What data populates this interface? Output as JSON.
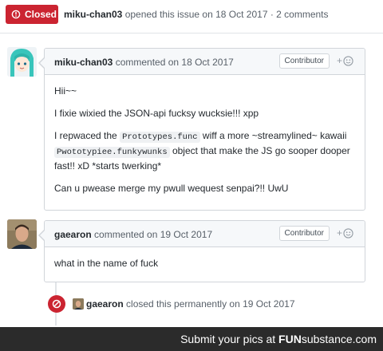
{
  "header": {
    "state_label": "Closed",
    "author": "miku-chan03",
    "meta": "opened this issue on 18 Oct 2017 · 2 comments"
  },
  "comments": [
    {
      "author": "miku-chan03",
      "meta": "commented on 18 Oct 2017",
      "role": "Contributor",
      "paragraphs": {
        "p1": "Hii~~",
        "p2": "I fixie wixied the JSON-api fucksy wucksie!!! xpp",
        "p3_before": "I repwaced the ",
        "p3_code1": "Prototypes.func",
        "p3_mid": " wiff a more ~streamylined~ kawaii ",
        "p3_code2": "Pwototypiee.funkywunks",
        "p3_after": " object that make the JS go sooper dooper fast!! xD *starts twerking*",
        "p4": "Can u pwease merge my pwull wequest senpai?!! UwU"
      }
    },
    {
      "author": "gaearon",
      "meta": "commented on 19 Oct 2017",
      "role": "Contributor",
      "body": "what in the name of fuck"
    }
  ],
  "event": {
    "actor": "gaearon",
    "action": "closed this permanently on 19 Oct 2017"
  },
  "footer": {
    "text": "Submit your pics at",
    "brand_bold": "FUN",
    "brand_rest": "substance.com"
  },
  "colors": {
    "closed_red": "#cb2431",
    "header_bg": "#f6f8fa",
    "border": "#d1d5da",
    "footer_bg": "#2b2b2b"
  },
  "icons": [
    "issue-closed-icon",
    "add-reaction-icon",
    "circle-slash-icon"
  ]
}
